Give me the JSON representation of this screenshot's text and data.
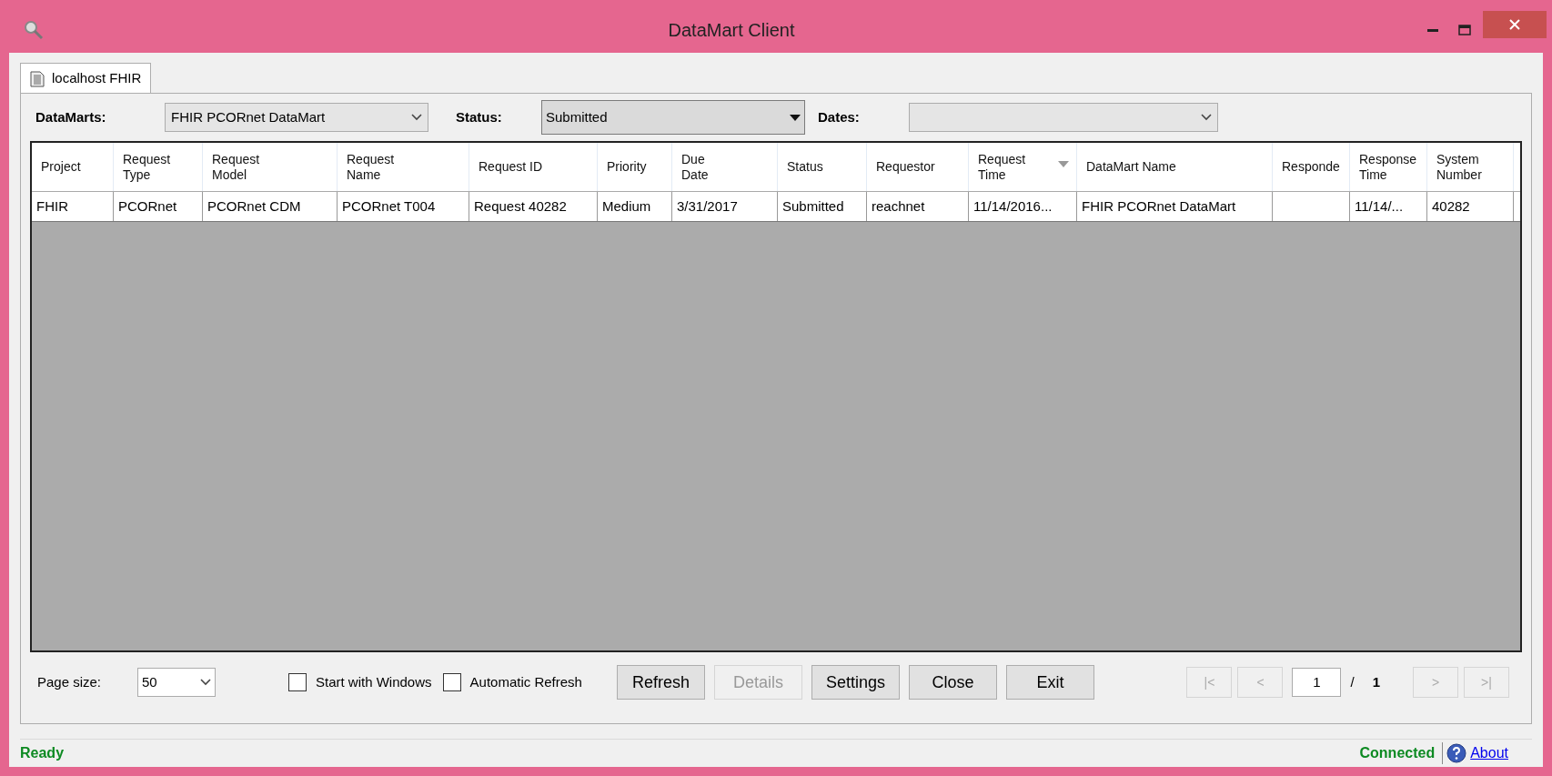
{
  "window": {
    "title": "DataMart Client"
  },
  "tabs": [
    {
      "label": "localhost FHIR",
      "selected": true
    }
  ],
  "filters": {
    "datamarts": {
      "label": "DataMarts:",
      "value": "FHIR PCORnet DataMart"
    },
    "status": {
      "label": "Status:",
      "value": "Submitted"
    },
    "dates": {
      "label": "Dates:"
    }
  },
  "table": {
    "columns": [
      {
        "lines": [
          "Project"
        ],
        "sorted": false
      },
      {
        "lines": [
          "Request",
          "Type"
        ],
        "sorted": false
      },
      {
        "lines": [
          "Request",
          "Model"
        ],
        "sorted": false
      },
      {
        "lines": [
          "Request",
          "Name"
        ],
        "sorted": false
      },
      {
        "lines": [
          "Request ID"
        ],
        "sorted": false
      },
      {
        "lines": [
          "Priority"
        ],
        "sorted": false
      },
      {
        "lines": [
          "Due",
          "Date"
        ],
        "sorted": false
      },
      {
        "lines": [
          "Status"
        ],
        "sorted": false
      },
      {
        "lines": [
          "Requestor"
        ],
        "sorted": false
      },
      {
        "lines": [
          "Request",
          "Time"
        ],
        "sorted": true
      },
      {
        "lines": [
          "DataMart Name"
        ],
        "sorted": false
      },
      {
        "lines": [
          "Responde"
        ],
        "sorted": false
      },
      {
        "lines": [
          "Response",
          "Time"
        ],
        "sorted": false
      },
      {
        "lines": [
          "System",
          "Number"
        ],
        "sorted": false
      }
    ],
    "rows": [
      {
        "cells": [
          "FHIR",
          "PCORnet",
          "PCORnet CDM",
          "PCORnet T004",
          "Request 40282",
          "Medium",
          "3/31/2017",
          "Submitted",
          "reachnet",
          "11/14/2016...",
          "FHIR PCORnet DataMart",
          "",
          "11/14/...",
          "40282"
        ]
      }
    ]
  },
  "footer": {
    "page_size": {
      "label": "Page size:",
      "value": "50"
    },
    "checkboxes": [
      {
        "label": "Start with Windows",
        "checked": false
      },
      {
        "label": "Automatic Refresh",
        "checked": false
      }
    ],
    "buttons": [
      {
        "label": "Refresh",
        "disabled": false
      },
      {
        "label": "Details",
        "disabled": true
      },
      {
        "label": "Settings",
        "disabled": false
      },
      {
        "label": "Close",
        "disabled": false
      },
      {
        "label": "Exit",
        "disabled": false
      }
    ],
    "pagination": {
      "first": {
        "label": "|<",
        "disabled": true
      },
      "prev": {
        "label": "<",
        "disabled": true
      },
      "page": "1",
      "separator": "/",
      "total": "1",
      "next": {
        "label": ">",
        "disabled": true
      },
      "last": {
        "label": ">|",
        "disabled": true
      }
    }
  },
  "status_bar": {
    "status": "Ready",
    "connection": "Connected",
    "link": "About"
  }
}
